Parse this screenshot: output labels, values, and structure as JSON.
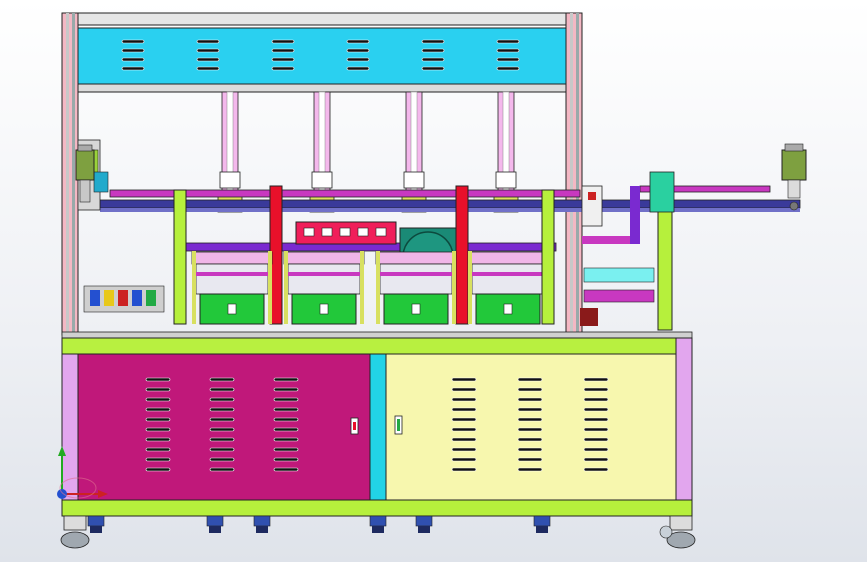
{
  "viewport": {
    "label": "",
    "background_top": "#ffffff",
    "background_bottom": "#dfe3ea"
  },
  "colors": {
    "upper_panel": "#2ad0f0",
    "frame_post": "#f4b8c4",
    "frame_post_grey": "#c8c8c8",
    "cabinet_left_door": "#c0187a",
    "cabinet_right_door": "#f7f7ae",
    "cabinet_divider": "#22d3e6",
    "cabinet_side": "#e2a6ee",
    "base_frame": "#b6f03c",
    "table_top": "#b8f040",
    "motor_green": "#22c83a",
    "fixture_purple": "#8a3cd8",
    "red_column": "#e8102a",
    "teal_disk": "#1a8a76",
    "magenta_rail": "#c838c0",
    "lavender_bracket": "#f0b6e8",
    "caster": "#a0a8b0",
    "foot_blue": "#3050b0"
  },
  "icons": {
    "axis_triad": "xyz-axis-triad-icon",
    "door_lock_left": "door-lock-icon",
    "door_lock_right": "door-handle-icon",
    "servo_motor_left": "servo-motor-icon",
    "servo_motor_right": "servo-motor-icon"
  },
  "counts": {
    "stations": 4,
    "vertical_cylinders": 4,
    "caster_wheels": 2,
    "leveling_feet": 6
  }
}
